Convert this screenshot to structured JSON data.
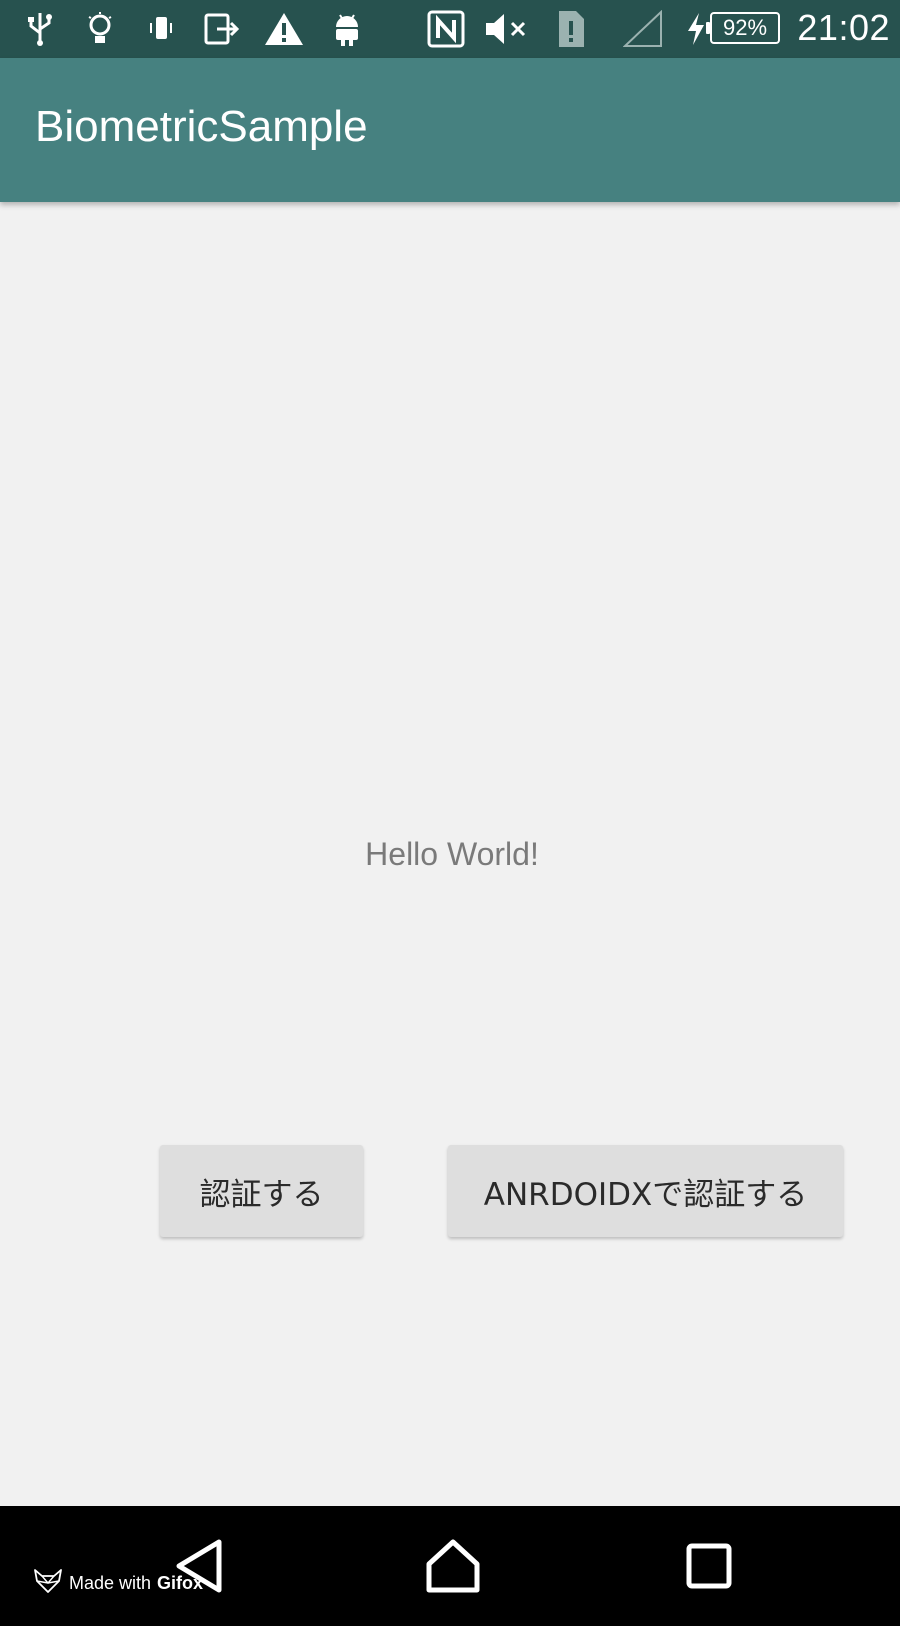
{
  "status_bar": {
    "icons": [
      "usb-icon",
      "lightbulb-icon",
      "phone-vibrate-icon",
      "screen-mirroring-icon",
      "warning-icon",
      "android-icon",
      "nfc-icon",
      "volume-muted-icon",
      "sim-alert-icon",
      "signal-icon",
      "charging-bolt-icon"
    ],
    "battery": "92%",
    "time": "21:02"
  },
  "app_bar": {
    "title": "BiometricSample",
    "color": "#468180"
  },
  "main": {
    "hello_text": "Hello World!",
    "buttons": {
      "authenticate": "認証する",
      "authenticate_androidx": "ANRDOIDXで認証する"
    }
  },
  "nav_bar": {
    "icons": [
      "back-icon",
      "home-icon",
      "recents-icon"
    ]
  },
  "watermark": {
    "prefix": "Made with",
    "brand": "Gifox"
  }
}
